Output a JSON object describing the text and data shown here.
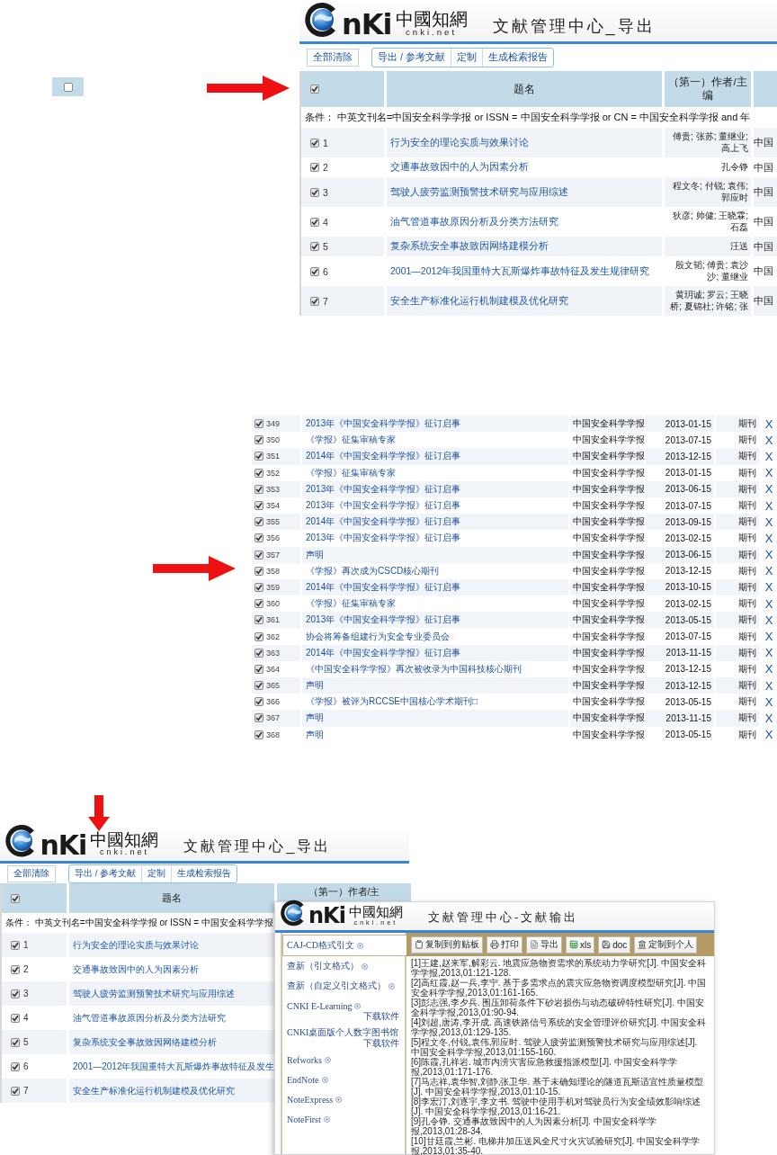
{
  "standalone_checkbox": {
    "checked": false
  },
  "export_page": {
    "logo": {
      "mark": "nKi",
      "chinese": "中國知網",
      "domain": "cnki.net"
    },
    "title": "文献管理中心_导出",
    "clear_button": "全部清除",
    "tools": [
      "导出 / 参考文献",
      "定制",
      "生成检索报告"
    ],
    "table": {
      "header_checked": true,
      "columns": [
        "题名",
        "（第一）作者/主编"
      ],
      "condition": "条件： 中英文刊名=中国安全科学学报 or ISSN = 中国安全科学学报 or CN = 中国安全科学学报 and 年",
      "rows": [
        {
          "checked": true,
          "number": "1",
          "title": "行为安全的理论实质与效果讨论",
          "author": "傅贵; 张苏; 董继业; 高上飞",
          "column_4": "中国"
        },
        {
          "checked": true,
          "number": "2",
          "title": "交通事故致因中的人为因素分析",
          "author": "孔令铮",
          "column_4": "中国"
        },
        {
          "checked": true,
          "number": "3",
          "title": "驾驶人疲劳监测预警技术研究与应用综述",
          "author": "程文冬; 付锐; 袁伟; 郭应时",
          "column_4": "中国"
        },
        {
          "checked": true,
          "number": "4",
          "title": "油气管道事故原因分析及分类方法研究",
          "author": "狄彦; 帅健; 王晓霖; 石磊",
          "column_4": "中国"
        },
        {
          "checked": true,
          "number": "5",
          "title": "复杂系统安全事故致因网络建模分析",
          "author": "汪送",
          "column_4": "中国"
        },
        {
          "checked": true,
          "number": "6",
          "title": "2001—2012年我国重特大瓦斯爆炸事故特征及发生规律研究",
          "author": "殷文韬; 傅贵; 袁沙沙; 董继业",
          "column_4": "中国"
        },
        {
          "checked": true,
          "number": "7",
          "title": "安全生产标准化运行机制建模及优化研究",
          "author": "黄玥诚; 罗云; 王晓桥; 夏锦社; 许铭; 张",
          "column_4": "中国"
        }
      ]
    }
  },
  "result_list": {
    "rows": [
      {
        "checked": true,
        "number": "349",
        "title": "2013年《中国安全科学学报》征订启事",
        "journal": "中国安全科学学报",
        "date": "2013-01-15",
        "type": "期刊",
        "delete": "X"
      },
      {
        "checked": true,
        "number": "350",
        "title": "《学报》征集审稿专家",
        "journal": "中国安全科学学报",
        "date": "2013-07-15",
        "type": "期刊",
        "delete": "X"
      },
      {
        "checked": true,
        "number": "351",
        "title": "2014年《中国安全科学学报》征订启事",
        "journal": "中国安全科学学报",
        "date": "2013-12-15",
        "type": "期刊",
        "delete": "X"
      },
      {
        "checked": true,
        "number": "352",
        "title": "《学报》征集审稿专家",
        "journal": "中国安全科学学报",
        "date": "2013-01-15",
        "type": "期刊",
        "delete": "X"
      },
      {
        "checked": true,
        "number": "353",
        "title": "2013年《中国安全科学学报》征订启事",
        "journal": "中国安全科学学报",
        "date": "2013-06-15",
        "type": "期刊",
        "delete": "X"
      },
      {
        "checked": true,
        "number": "354",
        "title": "2013年《中国安全科学学报》征订启事",
        "journal": "中国安全科学学报",
        "date": "2013-07-15",
        "type": "期刊",
        "delete": "X"
      },
      {
        "checked": true,
        "number": "355",
        "title": "2014年《中国安全科学学报》征订启事",
        "journal": "中国安全科学学报",
        "date": "2013-09-15",
        "type": "期刊",
        "delete": "X"
      },
      {
        "checked": true,
        "number": "356",
        "title": "2013年《中国安全科学学报》征订启事",
        "journal": "中国安全科学学报",
        "date": "2013-02-15",
        "type": "期刊",
        "delete": "X"
      },
      {
        "checked": true,
        "number": "357",
        "title": "声明",
        "journal": "中国安全科学学报",
        "date": "2013-06-15",
        "type": "期刊",
        "delete": "X"
      },
      {
        "checked": true,
        "number": "358",
        "title": "《学报》再次成为CSCD核心期刊",
        "journal": "中国安全科学学报",
        "date": "2013-12-15",
        "type": "期刊",
        "delete": "X"
      },
      {
        "checked": true,
        "number": "359",
        "title": "2014年《中国安全科学学报》征订启事",
        "journal": "中国安全科学学报",
        "date": "2013-10-15",
        "type": "期刊",
        "delete": "X"
      },
      {
        "checked": true,
        "number": "360",
        "title": "《学报》征集审稿专家",
        "journal": "中国安全科学学报",
        "date": "2013-02-15",
        "type": "期刊",
        "delete": "X"
      },
      {
        "checked": true,
        "number": "361",
        "title": "2013年《中国安全科学学报》征订启事",
        "journal": "中国安全科学学报",
        "date": "2013-05-15",
        "type": "期刊",
        "delete": "X"
      },
      {
        "checked": true,
        "number": "362",
        "title": "协会将筹备组建行为安全专业委员会",
        "journal": "中国安全科学学报",
        "date": "2013-07-15",
        "type": "期刊",
        "delete": "X"
      },
      {
        "checked": true,
        "number": "363",
        "title": "2014年《中国安全科学学报》征订启事",
        "journal": "中国安全科学学报",
        "date": "2013-11-15",
        "type": "期刊",
        "delete": "X"
      },
      {
        "checked": true,
        "number": "364",
        "title": "《中国安全科学学报》再次被收录为中国科技核心期刊",
        "journal": "中国安全科学学报",
        "date": "2013-12-15",
        "type": "期刊",
        "delete": "X"
      },
      {
        "checked": true,
        "number": "365",
        "title": "声明",
        "journal": "中国安全科学学报",
        "date": "2013-12-15",
        "type": "期刊",
        "delete": "X"
      },
      {
        "checked": true,
        "number": "366",
        "title": "《学报》被评为RCCSE中国核心学术期刊□",
        "journal": "中国安全科学学报",
        "date": "2013-05-15",
        "type": "期刊",
        "delete": "X"
      },
      {
        "checked": true,
        "number": "367",
        "title": "声明",
        "journal": "中国安全科学学报",
        "date": "2013-11-15",
        "type": "期刊",
        "delete": "X"
      },
      {
        "checked": true,
        "number": "368",
        "title": "声明",
        "journal": "中国安全科学学报",
        "date": "2013-05-15",
        "type": "期刊",
        "delete": "X"
      }
    ]
  },
  "export_page_2": {
    "logo": {
      "mark": "nKi",
      "chinese": "中國知網",
      "domain": "cnki.net"
    },
    "title": "文献管理中心_导出",
    "clear_button": "全部清除",
    "tools": [
      "导出 / 参考文献",
      "定制",
      "生成检索报告"
    ],
    "table": {
      "header_checked": true,
      "columns": [
        "题名",
        "（第一）作者/主"
      ],
      "condition": "条件： 中英文刊名=中国安全科学学报 or ISSN = 中国安全科学学报",
      "rows": [
        {
          "checked": true,
          "number": "1",
          "title": "行为安全的理论实质与效果讨论"
        },
        {
          "checked": true,
          "number": "2",
          "title": "交通事故致因中的人为因素分析"
        },
        {
          "checked": true,
          "number": "3",
          "title": "驾驶人疲劳监测预警技术研究与应用综述"
        },
        {
          "checked": true,
          "number": "4",
          "title": "油气管道事故原因分析及分类方法研究"
        },
        {
          "checked": true,
          "number": "5",
          "title": "复杂系统安全事故致因网络建模分析"
        },
        {
          "checked": true,
          "number": "6",
          "title": "2001—2012年我国重特大瓦斯爆炸事故特征及发生"
        },
        {
          "checked": true,
          "number": "7",
          "title": "安全生产标准化运行机制建模及优化研究"
        }
      ]
    }
  },
  "output_window": {
    "logo": {
      "mark": "nKi",
      "chinese": "中國知網",
      "domain": "cnki.net"
    },
    "title": "文献管理中心-文献输出",
    "formats": [
      {
        "label": "CAJ-CD格式引文",
        "selected": true
      },
      {
        "label": "查新（引文格式）",
        "selected": false
      },
      {
        "label": "查新（自定义引文格式）",
        "selected": false
      },
      {
        "label": "CNKI E-Learning",
        "selected": false,
        "download": "下载软件"
      },
      {
        "label": "CNKI桌面版个人数字图书馆",
        "selected": false,
        "download": "下载软件"
      },
      {
        "label": "Refworks",
        "selected": false
      },
      {
        "label": "EndNote",
        "selected": false
      },
      {
        "label": "NoteExpress",
        "selected": false
      },
      {
        "label": "NoteFirst",
        "selected": false
      }
    ],
    "toolbar": [
      {
        "kind": "copy",
        "label": "复制到剪贴板"
      },
      {
        "kind": "print",
        "label": "打印"
      },
      {
        "kind": "export",
        "label": "导出"
      },
      {
        "kind": "xls",
        "label": "xls"
      },
      {
        "kind": "doc",
        "label": "doc"
      },
      {
        "kind": "custom",
        "label": "定制到个人"
      }
    ],
    "references": [
      "[1]王建,赵来军,解彩云. 地震应急物资需求的系统动力学研究[J]. 中国安全科学学报,2013,01:121-128.",
      "[2]高红霞,赵一兵,李宁. 基于多需求点的震灾应急物资调度模型研究[J]. 中国安全科学学报,2013,01:161-165.",
      "[3]彭志强,李夕兵. 围压卸荷条件下砂岩损伤与动态破碎特性研究[J]. 中国安全科学学报,2013,01:90-94.",
      "[4]刘超,唐涛,李开成. 高速铁路信号系统的安全管理评价研究[J]. 中国安全科学学报,2013,01:129-135.",
      "[5]程文冬,付锐,袁伟,郭应时. 驾驶人疲劳监测预警技术研究与应用综述[J]. 中国安全科学学报,2013,01:155-160.",
      "[6]陈霞,孔祥岩. 城市内涝灾害应急救援指派模型[J]. 中国安全科学学报,2013,01:171-176.",
      "[7]马志祥,袁华智,刘静,张卫华. 基于未确知理论的隧道瓦斯适宜性质量模型[J]. 中国安全科学学报,2013,01:10-15.",
      "[8]李宏汀,刘逐宇,李文书. 驾驶中使用手机对驾驶员行为安全绩效影响综述[J]. 中国安全科学学报,2013,01:16-21.",
      "[9]孔令铮. 交通事故致因中的人为因素分析[J]. 中国安全科学学报,2013,01:28-34.",
      "[10]甘廷霞,兰彬. 电梯井加压送风全尺寸火灾试验研究[J]. 中国安全科学学报,2013,01:35-40."
    ]
  }
}
